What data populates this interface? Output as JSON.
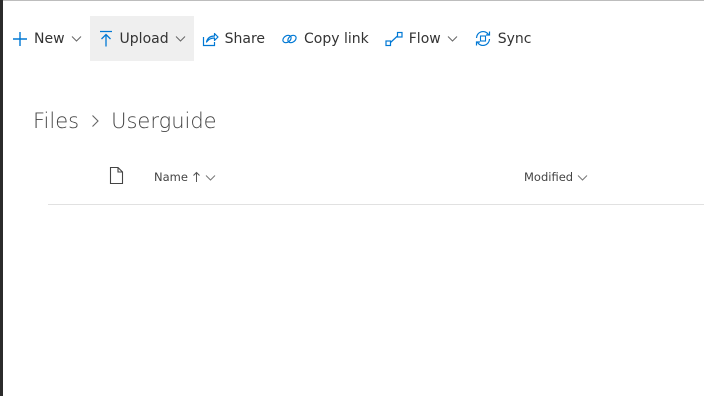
{
  "toolbar": {
    "new_label": "New",
    "upload_label": "Upload",
    "share_label": "Share",
    "copy_link_label": "Copy link",
    "flow_label": "Flow",
    "sync_label": "Sync"
  },
  "breadcrumb": {
    "items": [
      "Files",
      "Userguide"
    ]
  },
  "list": {
    "columns": [
      "Name",
      "Modified"
    ],
    "sort": {
      "column": "Name",
      "direction": "ascending"
    }
  },
  "colors": {
    "accent": "#0078d4",
    "active_button_bg": "#efefef",
    "divider": "#e1e1e1"
  },
  "icons": [
    "plus-icon",
    "upload-icon",
    "share-icon",
    "link-icon",
    "flow-icon",
    "sync-icon",
    "chevron-down-icon",
    "chevron-right-icon",
    "file-icon",
    "sort-up-icon"
  ]
}
